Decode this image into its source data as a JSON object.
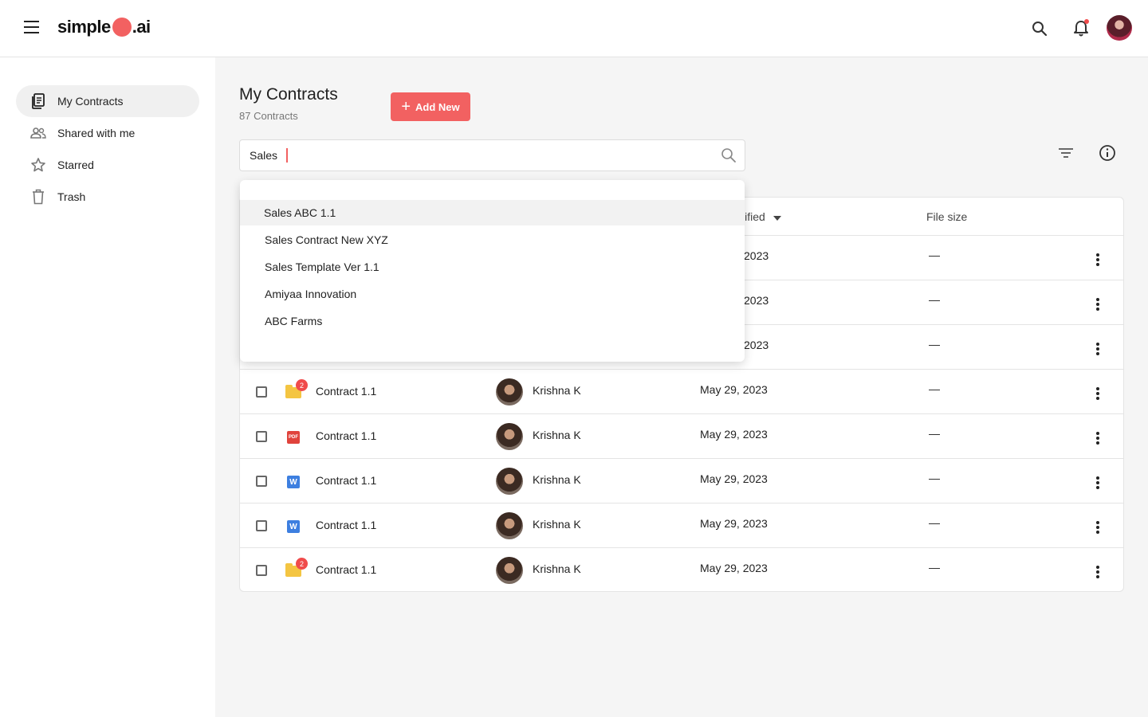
{
  "brand": {
    "prefix": "simple",
    "suffix": ".ai",
    "accent": "#f26161"
  },
  "header": {
    "icons": [
      "hamburger-icon",
      "search-icon",
      "bell-icon",
      "user-avatar"
    ]
  },
  "sidebar": {
    "items": [
      {
        "label": "My Contracts",
        "icon": "document-icon",
        "active": true
      },
      {
        "label": "Shared with me",
        "icon": "people-icon",
        "active": false
      },
      {
        "label": "Starred",
        "icon": "star-icon",
        "active": false
      },
      {
        "label": "Trash",
        "icon": "trash-icon",
        "active": false
      }
    ]
  },
  "main": {
    "title": "My Contracts",
    "subtitle": "87 Contracts",
    "add_button": "Add New",
    "search": {
      "value": "Sales"
    }
  },
  "suggestions": [
    "Sales ABC 1.1",
    "Sales Contract New XYZ",
    "Sales Template Ver 1.1",
    "Amiyaa Innovation",
    "ABC Farms"
  ],
  "table": {
    "columns": {
      "modified_partial": "lified",
      "size": "File size"
    },
    "hidden_rows": [
      {
        "modified_partial": "2023",
        "size": "—"
      },
      {
        "modified_partial": "2023",
        "size": "—"
      },
      {
        "modified_partial": "2023",
        "size": "—"
      }
    ],
    "rows": [
      {
        "type": "folder",
        "badge": "2",
        "name": "Contract 1.1",
        "owner": "Krishna K",
        "modified": "May 29, 2023",
        "size": "—"
      },
      {
        "type": "pdf",
        "icon_text": "PDF",
        "name": "Contract 1.1",
        "owner": "Krishna K",
        "modified": "May 29, 2023",
        "size": "—"
      },
      {
        "type": "word",
        "icon_text": "W",
        "name": "Contract 1.1",
        "owner": "Krishna K",
        "modified": "May 29, 2023",
        "size": "—"
      },
      {
        "type": "word",
        "icon_text": "W",
        "name": "Contract 1.1",
        "owner": "Krishna K",
        "modified": "May 29, 2023",
        "size": "—"
      },
      {
        "type": "folder",
        "badge": "2",
        "name": "Contract 1.1",
        "owner": "Krishna K",
        "modified": "May 29, 2023",
        "size": "—"
      }
    ]
  }
}
